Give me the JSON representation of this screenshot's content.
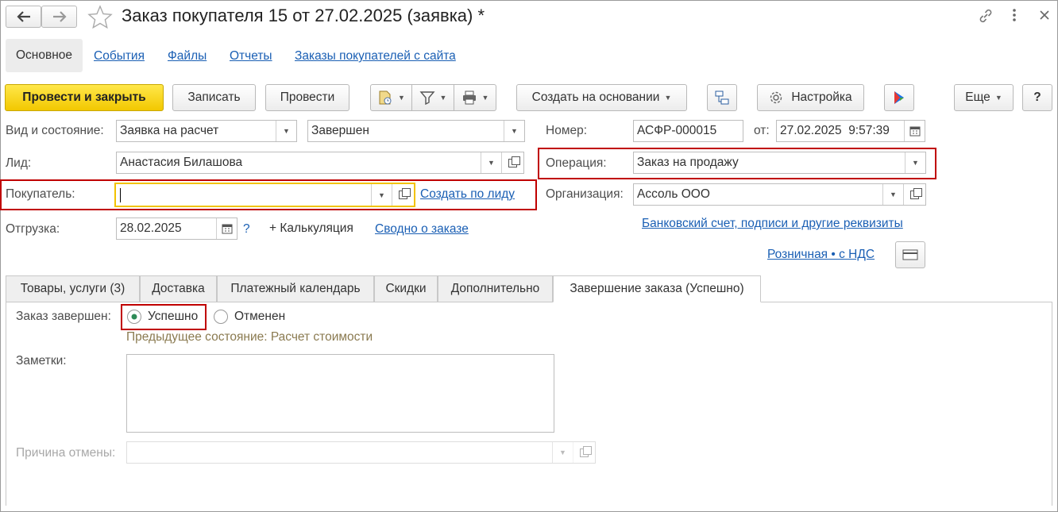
{
  "window": {
    "title": "Заказ покупателя 15 от 27.02.2025 (заявка) *"
  },
  "nav": {
    "items": [
      "Основное",
      "События",
      "Файлы",
      "Отчеты",
      "Заказы покупателей с сайта"
    ]
  },
  "toolbar": {
    "post_close": "Провести и закрыть",
    "write": "Записать",
    "post": "Провести",
    "create_based": "Создать на основании",
    "settings": "Настройка",
    "more": "Еще",
    "help": "?"
  },
  "form": {
    "kind_label": "Вид и состояние:",
    "kind_value": "Заявка на расчет",
    "state_value": "Завершен",
    "number_label": "Номер:",
    "number_value": "АСФР-000015",
    "from_label": "от:",
    "date_value": "27.02.2025  9:57:39",
    "lead_label": "Лид:",
    "lead_value": "Анастасия Билашова",
    "operation_label": "Операция:",
    "operation_value": "Заказ на продажу",
    "buyer_label": "Покупатель:",
    "buyer_value": "",
    "create_by_lead": "Создать по лиду",
    "org_label": "Организация:",
    "org_value": "Ассоль ООО",
    "shipment_label": "Отгрузка:",
    "shipment_value": "28.02.2025",
    "shipment_help": "?",
    "calc": "+ Калькуляция",
    "summary_link": "Сводно о заказе",
    "bank_link": "Банковский счет, подписи и другие реквизиты",
    "price_link": "Розничная • с НДС"
  },
  "tabs": [
    "Товары, услуги (3)",
    "Доставка",
    "Платежный календарь",
    "Скидки",
    "Дополнительно",
    "Завершение заказа (Успешно)"
  ],
  "completion": {
    "label": "Заказ завершен:",
    "option_success": "Успешно",
    "option_cancel": "Отменен",
    "selected": "Успешно",
    "prev_state": "Предыдущее состояние: Расчет стоимости",
    "notes_label": "Заметки:",
    "notes_value": "",
    "cancel_reason_label": "Причина отмены:",
    "cancel_reason_value": ""
  },
  "colors": {
    "primary_button": "#f5d000",
    "link": "#1a5fb4",
    "highlight_box": "#c00000",
    "radio_selected": "#2e8b57"
  }
}
